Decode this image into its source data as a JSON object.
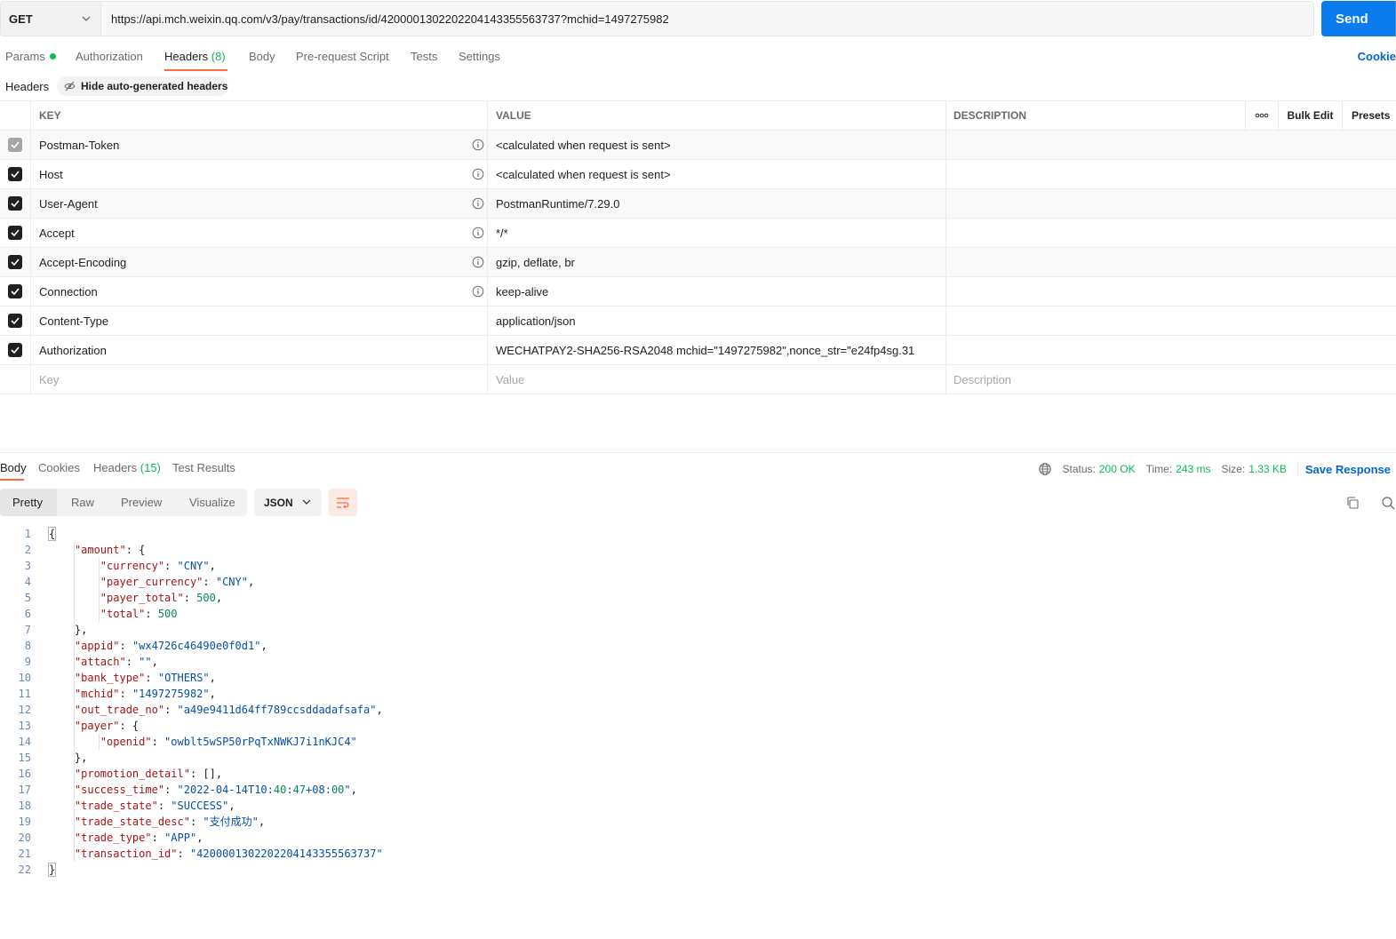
{
  "request": {
    "method": "GET",
    "url": "https://api.mch.weixin.qq.com/v3/pay/transactions/id/4200001302202204143355563737?mchid=1497275982",
    "send_label": "Send"
  },
  "request_tabs": [
    {
      "label": "Params",
      "count": ""
    },
    {
      "label": "Authorization",
      "count": ""
    },
    {
      "label": "Headers",
      "count": "(8)"
    },
    {
      "label": "Body",
      "count": ""
    },
    {
      "label": "Pre-request Script",
      "count": ""
    },
    {
      "label": "Tests",
      "count": ""
    },
    {
      "label": "Settings",
      "count": ""
    }
  ],
  "cookies_label": "Cookie",
  "headers_section": {
    "label": "Headers",
    "hide_auto_label": "Hide auto-generated headers"
  },
  "table": {
    "columns": {
      "key": "KEY",
      "value": "VALUE",
      "description": "DESCRIPTION",
      "bulk_edit": "Bulk Edit",
      "presets": "Presets"
    },
    "rows": [
      {
        "key": "Postman-Token",
        "value": "<calculated when request is sent>"
      },
      {
        "key": "Host",
        "value": "<calculated when request is sent>"
      },
      {
        "key": "User-Agent",
        "value": "PostmanRuntime/7.29.0"
      },
      {
        "key": "Accept",
        "value": "*/*"
      },
      {
        "key": "Accept-Encoding",
        "value": "gzip, deflate, br"
      },
      {
        "key": "Connection",
        "value": "keep-alive"
      },
      {
        "key": "Content-Type",
        "value": "application/json"
      },
      {
        "key": "Authorization",
        "value": "WECHATPAY2-SHA256-RSA2048 mchid=\"1497275982\",nonce_str=\"e24fp4sg.31"
      }
    ],
    "placeholders": {
      "key": "Key",
      "value": "Value",
      "description": "Description"
    }
  },
  "response": {
    "tabs": [
      {
        "label": "Body",
        "count": ""
      },
      {
        "label": "Cookies",
        "count": ""
      },
      {
        "label": "Headers",
        "count": "(15)"
      },
      {
        "label": "Test Results",
        "count": ""
      }
    ],
    "status_label": "Status:",
    "status_value": "200 OK",
    "time_label": "Time:",
    "time_value": "243 ms",
    "size_label": "Size:",
    "size_value": "1.33 KB",
    "save_label": "Save Response",
    "views": [
      "Pretty",
      "Raw",
      "Preview",
      "Visualize"
    ],
    "format": "JSON"
  },
  "code_lines": [
    {
      "n": "1",
      "text": "{"
    },
    {
      "n": "2",
      "text": "    \"amount\": {"
    },
    {
      "n": "3",
      "text": "        \"currency\": \"CNY\","
    },
    {
      "n": "4",
      "text": "        \"payer_currency\": \"CNY\","
    },
    {
      "n": "5",
      "text": "        \"payer_total\": 500,"
    },
    {
      "n": "6",
      "text": "        \"total\": 500"
    },
    {
      "n": "7",
      "text": "    },"
    },
    {
      "n": "8",
      "text": "    \"appid\": \"wx4726c46490e0f0d1\","
    },
    {
      "n": "9",
      "text": "    \"attach\": \"\","
    },
    {
      "n": "10",
      "text": "    \"bank_type\": \"OTHERS\","
    },
    {
      "n": "11",
      "text": "    \"mchid\": \"1497275982\","
    },
    {
      "n": "12",
      "text": "    \"out_trade_no\": \"a49e9411d64ff789ccsddadafsafa\","
    },
    {
      "n": "13",
      "text": "    \"payer\": {"
    },
    {
      "n": "14",
      "text": "        \"openid\": \"owblt5wSP50rPqTxNWKJ7i1nKJC4\""
    },
    {
      "n": "15",
      "text": "    },"
    },
    {
      "n": "16",
      "text": "    \"promotion_detail\": [],"
    },
    {
      "n": "17",
      "text": "    \"success_time\": \"2022-04-14T10:40:47+08:00\","
    },
    {
      "n": "18",
      "text": "    \"trade_state\": \"SUCCESS\","
    },
    {
      "n": "19",
      "text": "    \"trade_state_desc\": \"支付成功\","
    },
    {
      "n": "20",
      "text": "    \"trade_type\": \"APP\","
    },
    {
      "n": "21",
      "text": "    \"transaction_id\": \"4200001302202204143355563737\""
    },
    {
      "n": "22",
      "text": "}"
    }
  ],
  "colors": {
    "accent": "#097bed",
    "tab_active": "#ff6c37",
    "success": "#0cbb52",
    "link": "#0265d2"
  },
  "icons": [
    "chevron-down-icon",
    "info-icon",
    "check-icon",
    "eye-off-icon",
    "globe-icon",
    "wrap-icon",
    "copy-icon",
    "search-icon",
    "more-icon"
  ]
}
